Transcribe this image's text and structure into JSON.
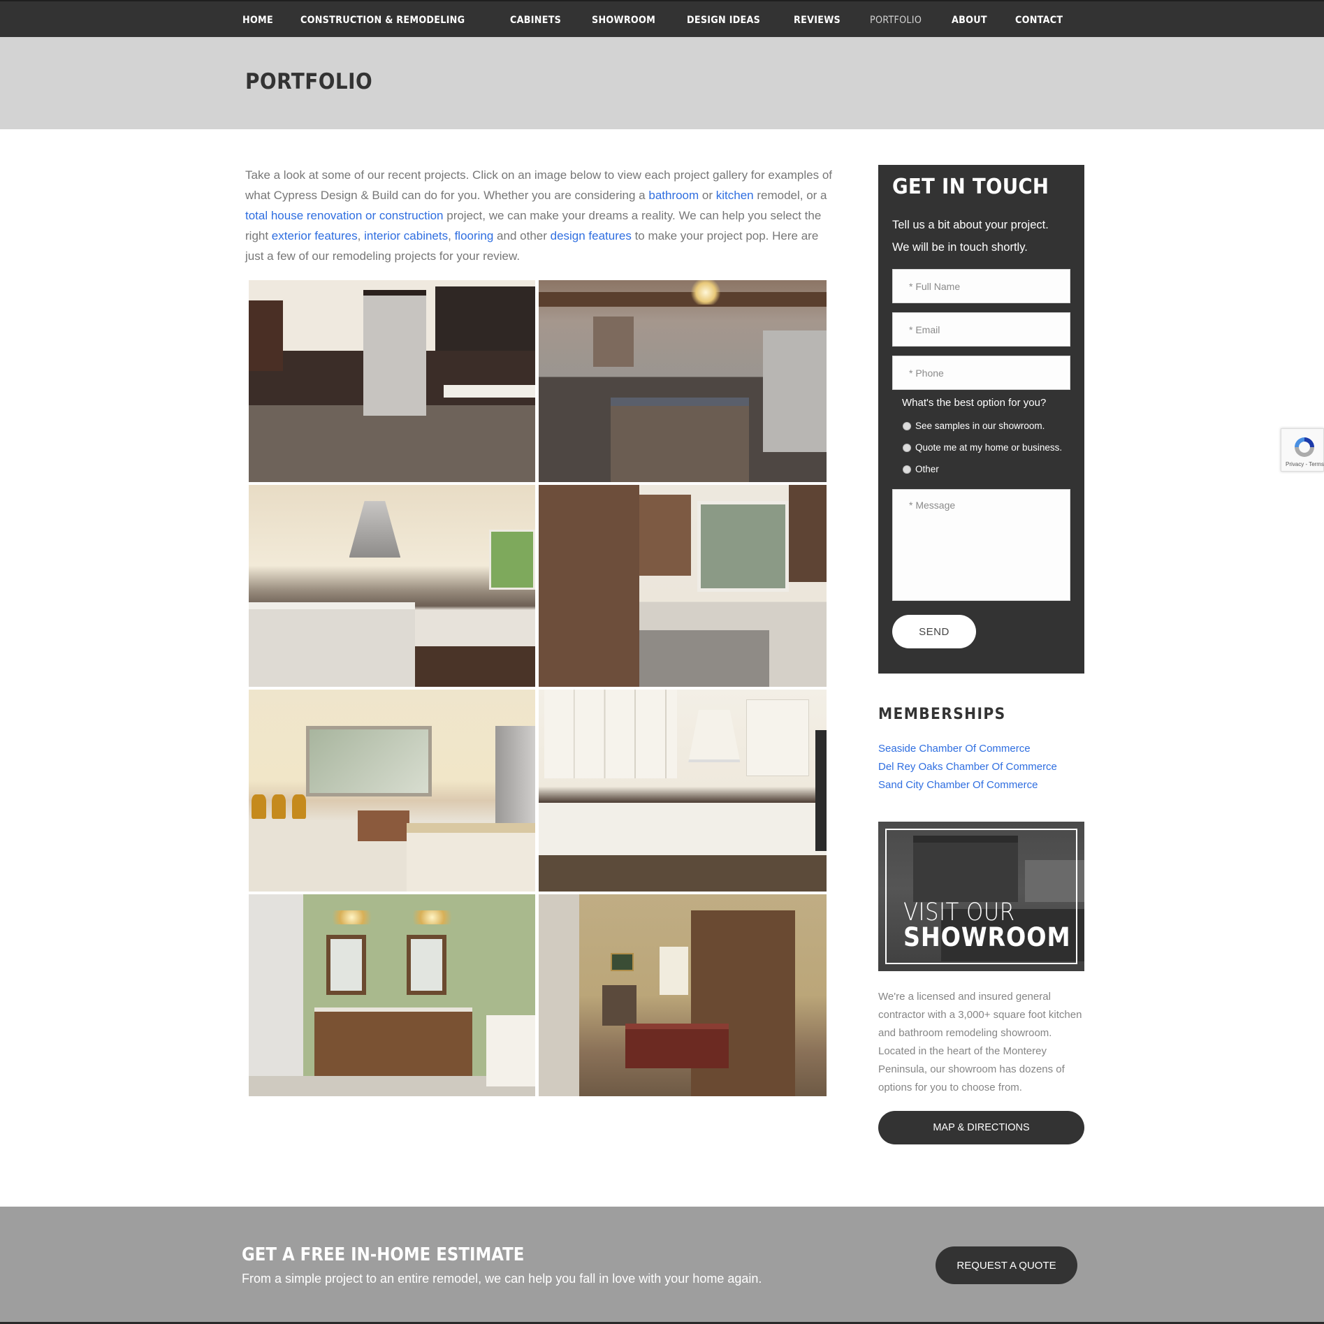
{
  "nav": {
    "items": [
      {
        "label": "HOME",
        "active": false
      },
      {
        "label": "CONSTRUCTION & REMODELING",
        "active": false
      },
      {
        "label": "CABINETS",
        "active": false
      },
      {
        "label": "SHOWROOM",
        "active": false
      },
      {
        "label": "DESIGN IDEAS",
        "active": false
      },
      {
        "label": "REVIEWS",
        "active": false
      },
      {
        "label": "PORTFOLIO",
        "active": true
      },
      {
        "label": "ABOUT",
        "active": false
      },
      {
        "label": "CONTACT",
        "active": false
      }
    ]
  },
  "page": {
    "title": "PORTFOLIO"
  },
  "intro": {
    "t1": "Take a look at some of our recent projects. Click on an image below to view each project gallery for examples of what Cypress Design & Build can do for you.  Whether you are considering a ",
    "link_bathroom": "bathroom",
    "t2": " or ",
    "link_kitchen": "kitchen",
    "t3": " remodel, or a ",
    "link_renovation": "total house renovation or construction",
    "t4": " project, we can make your dreams a reality.  We can help you select the right ",
    "link_exterior": "exterior features",
    "t5": ", ",
    "link_cabinets": "interior cabinets",
    "t6": ", ",
    "link_flooring": "flooring",
    "t7": " and other ",
    "link_design": "design features",
    "t8": " to make your project pop.  Here are just a few of our remodeling projects for your review."
  },
  "gallery": {
    "items": [
      {
        "subject": "kitchen with gray hood and dark cabinets"
      },
      {
        "subject": "kitchen with stained island and beamed ceiling"
      },
      {
        "subject": "white kitchen with stainless range hood"
      },
      {
        "subject": "wood cabinet kitchen with farmhouse sink"
      },
      {
        "subject": "cream kitchen with copper sink and granite island"
      },
      {
        "subject": "white U-shaped kitchen with pull-out drawer"
      },
      {
        "subject": "bathroom double vanity with green wallpaper"
      },
      {
        "subject": "bedroom with built-in wood cabinets"
      }
    ]
  },
  "contact_form": {
    "title": "GET IN TOUCH",
    "lead_line1": "Tell us a bit about your project.",
    "lead_line2": "We will be in touch shortly.",
    "name_placeholder": "* Full Name",
    "email_placeholder": "* Email",
    "phone_placeholder": "* Phone",
    "name_value": "",
    "email_value": "",
    "phone_value": "",
    "question": "What's the best option for you?",
    "options": [
      {
        "label": "See samples in our showroom.",
        "selected": false
      },
      {
        "label": "Quote me at my home or business.",
        "selected": false
      },
      {
        "label": "Other",
        "selected": false
      }
    ],
    "message_placeholder": "* Message",
    "message_value": "",
    "send_label": "SEND"
  },
  "memberships": {
    "title": "MEMBERSHIPS",
    "links": [
      "Seaside Chamber Of Commerce",
      "Del Rey Oaks Chamber Of Commerce",
      "Sand City Chamber Of Commerce"
    ]
  },
  "showroom_banner": {
    "line1": "VISIT OUR",
    "line2": "SHOWROOM"
  },
  "about": {
    "text": "We're a licensed and insured general contractor with a 3,000+ square foot kitchen and bathroom remodeling showroom. Located in the heart of the Monterey Peninsula, our showroom has dozens of options for you to choose from.",
    "map_button": "MAP & DIRECTIONS"
  },
  "cta": {
    "title": "GET A FREE IN-HOME ESTIMATE",
    "subtitle": "From a simple project to an entire remodel, we can help you fall in love with your home again.",
    "button": "REQUEST A QUOTE"
  },
  "recaptcha": {
    "icon": "recaptcha-logo",
    "text": "Privacy - Terms"
  },
  "colors": {
    "nav_bg": "#333333",
    "header_bg": "#d3d3d3",
    "link": "#2f6ee0",
    "panel_bg": "#333333",
    "cta_bg": "#9e9e9e",
    "body_text": "#777777"
  }
}
